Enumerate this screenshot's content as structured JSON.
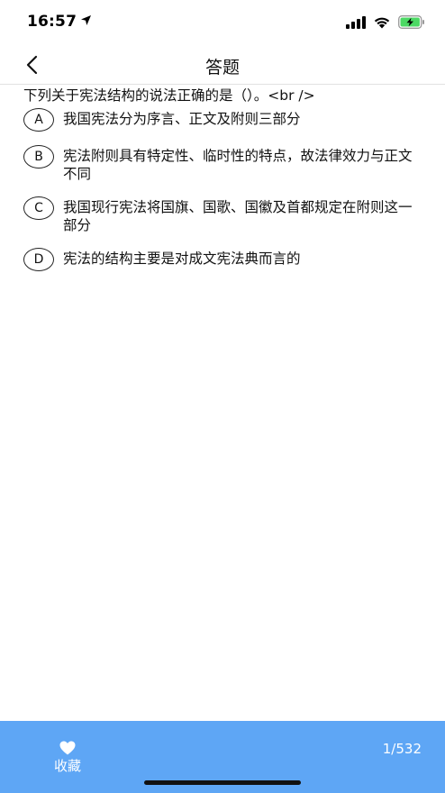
{
  "status": {
    "time": "16:57",
    "icons": [
      "location-arrow-icon",
      "cellular-signal-icon",
      "wifi-icon",
      "battery-charging-icon"
    ],
    "battery_color": "#4cd964"
  },
  "nav": {
    "title": "答题",
    "back_icon": "chevron-left-icon"
  },
  "question": {
    "text": "下列关于宪法结构的说法正确的是（）。<br />"
  },
  "options": [
    {
      "letter": "A",
      "text": "我国宪法分为序言、正文及附则三部分"
    },
    {
      "letter": "B",
      "text": "宪法附则具有特定性、临时性的特点，故法律效力与正文不同"
    },
    {
      "letter": "C",
      "text": "我国现行宪法将国旗、国歌、国徽及首都规定在附则这一部分"
    },
    {
      "letter": "D",
      "text": "宪法的结构主要是对成文宪法典而言的"
    }
  ],
  "bottom": {
    "favorite_label": "收藏",
    "favorite_icon": "heart-icon",
    "page_count": "1/532",
    "bar_color": "#5ea6f5"
  }
}
